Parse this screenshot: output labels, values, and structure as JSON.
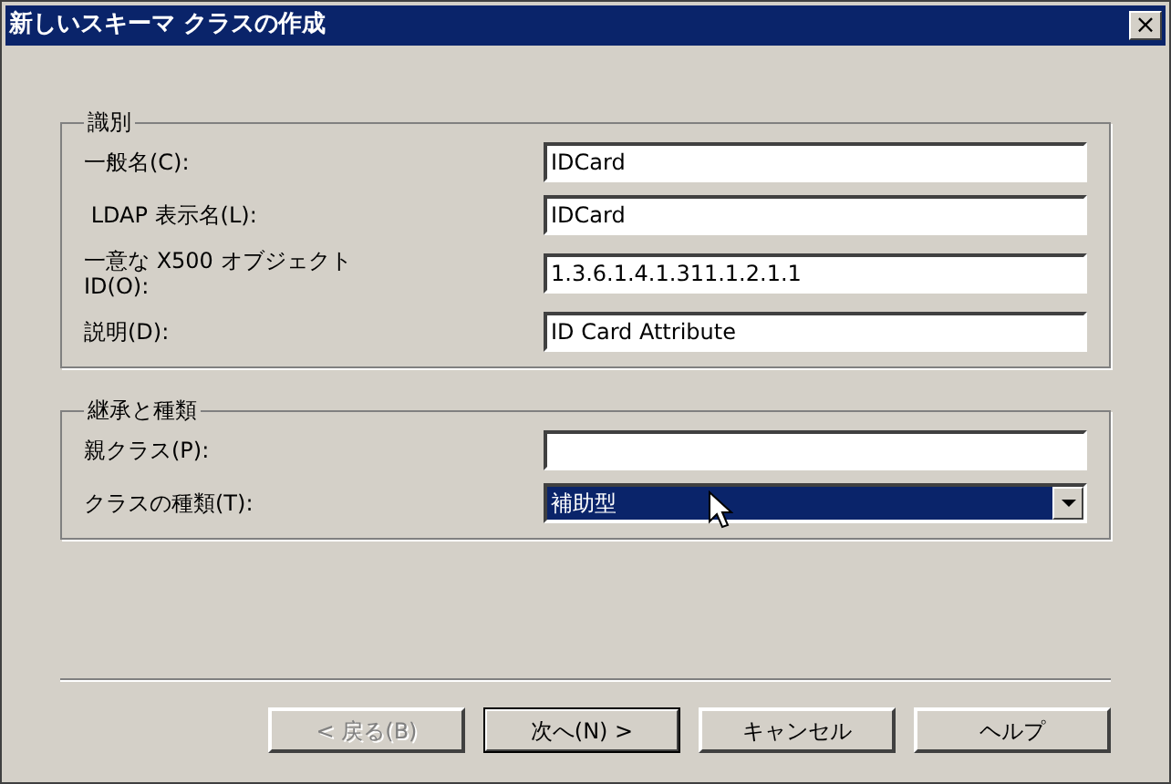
{
  "window": {
    "title": "新しいスキーマ クラスの作成",
    "close": "×"
  },
  "groups": [
    {
      "title": "識別",
      "fields": [
        {
          "kind": "text",
          "label": "一般名(C):",
          "value": "IDCard"
        },
        {
          "kind": "text",
          "label": " LDAP 表示名(L):",
          "value": "IDCard"
        },
        {
          "kind": "text",
          "label": "一意な X500 オブジェクト ID(O):",
          "value": "1.3.6.1.4.1.311.1.2.1.1"
        },
        {
          "kind": "text",
          "label": "説明(D):",
          "value": "ID Card Attribute"
        }
      ]
    },
    {
      "title": "継承と種類",
      "fields": [
        {
          "kind": "text",
          "label": "親クラス(P):"
        },
        {
          "kind": "select",
          "label": "クラスの種類(T):",
          "value": "補助型",
          "focused": true
        }
      ]
    }
  ],
  "buttons": [
    {
      "label": "< 戻る(B)",
      "disabled": true,
      "default": false
    },
    {
      "label": "次へ(N) >",
      "disabled": false,
      "default": true
    },
    {
      "label": "キャンセル",
      "disabled": false,
      "default": false
    },
    {
      "label": "ヘルプ",
      "disabled": false,
      "default": false
    }
  ]
}
